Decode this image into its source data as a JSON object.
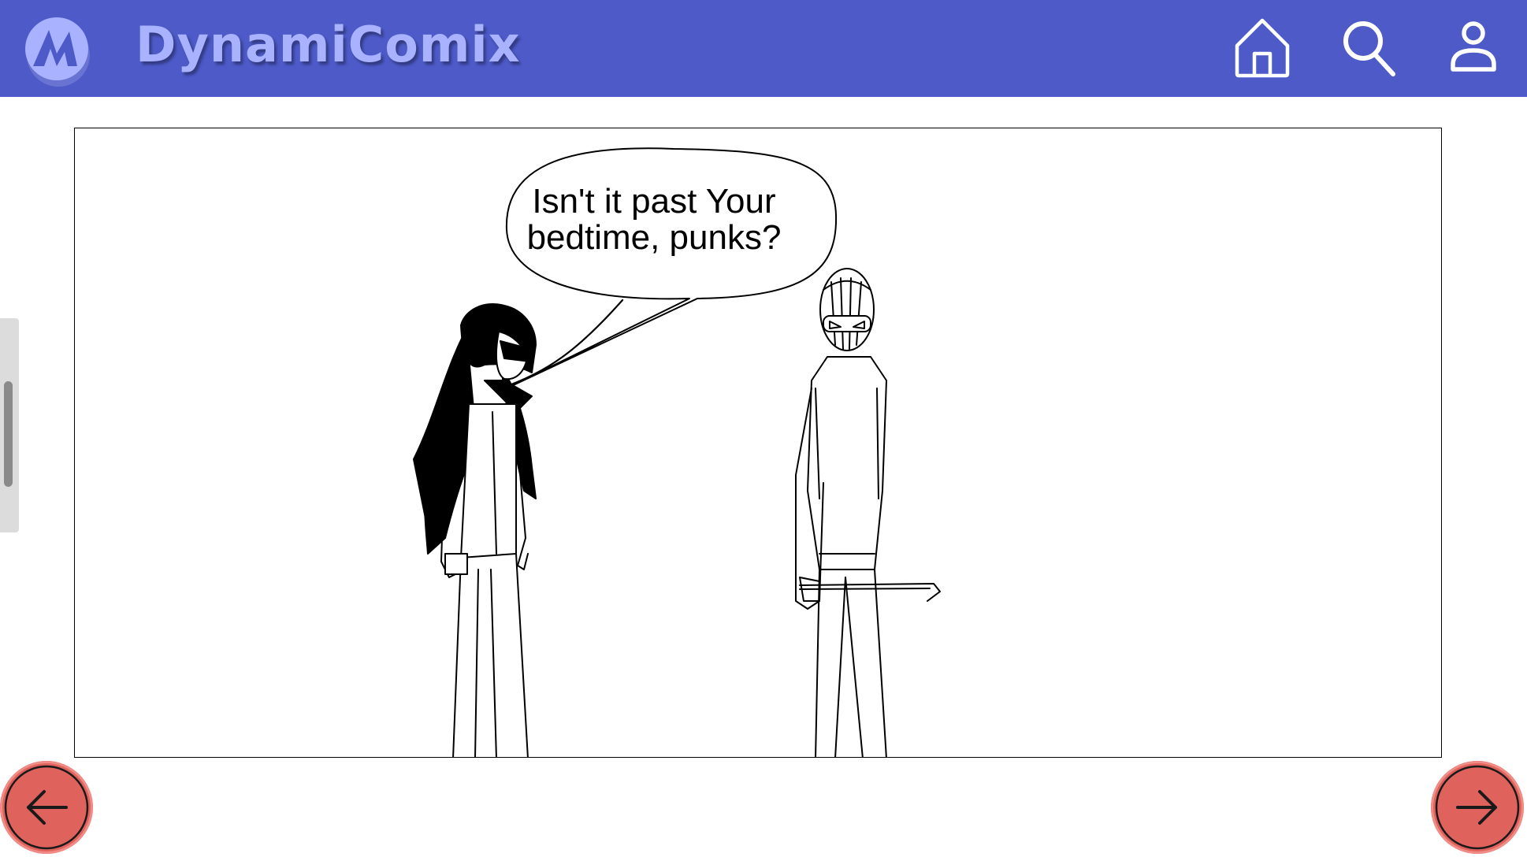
{
  "header": {
    "brand_name": "DynamiComix",
    "background_color": "#4d5ac8",
    "brand_color": "#a9b2ff",
    "icons": [
      "logo-icon",
      "home-icon",
      "search-icon",
      "profile-icon"
    ]
  },
  "comic": {
    "speech_bubble_text": "Isn't it past Your bedtime, punks?"
  },
  "navigation": {
    "prev_icon": "arrow-left-icon",
    "next_icon": "arrow-right-icon",
    "button_color": "#e0625d"
  },
  "scrollbar": {
    "position_fraction": 0.3
  }
}
